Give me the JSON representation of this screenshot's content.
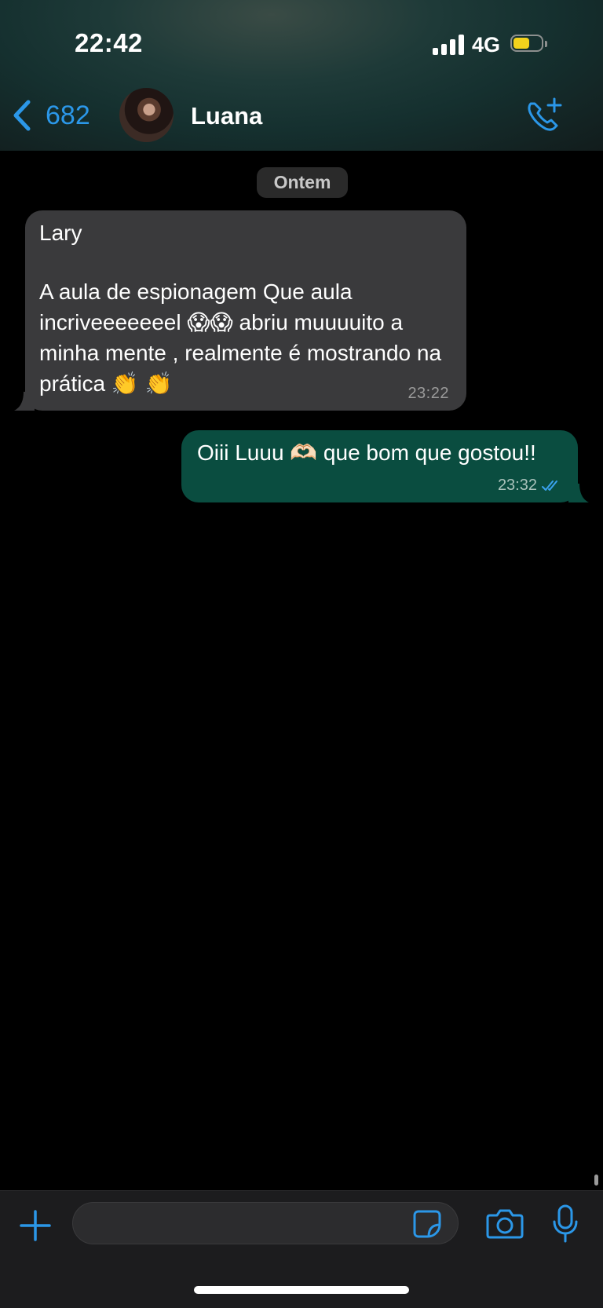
{
  "status_bar": {
    "time": "22:42",
    "network": "4G"
  },
  "header": {
    "back_count": "682",
    "contact_name": "Luana"
  },
  "chat": {
    "date_label": "Ontem",
    "messages": [
      {
        "direction": "in",
        "sender": "Lary",
        "text": "A aula de espionagem Que aula incriveeeeeeel 😱😱 abriu muuuuito a minha mente , realmente é mostrando na prática 👏 👏",
        "time": "23:22"
      },
      {
        "direction": "out",
        "text": "Oiii Luuu 🫶🏻 que bom que gostou!!",
        "time": "23:32",
        "read": true
      }
    ]
  },
  "composer": {
    "placeholder": ""
  },
  "colors": {
    "accent": "#2b97e8",
    "outgoing_bubble": "#0a4d40",
    "incoming_bubble": "#3a3a3c",
    "battery": "#f2d21c"
  }
}
